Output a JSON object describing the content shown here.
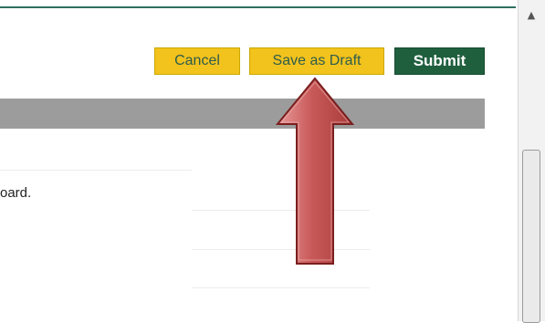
{
  "toolbar": {
    "cancel_label": "Cancel",
    "draft_label": "Save as Draft",
    "submit_label": "Submit"
  },
  "content": {
    "text": "oard."
  },
  "colors": {
    "accent_yellow": "#F2C21D",
    "submit_green": "#1F5F3E",
    "arrow_red": "#C95A5A"
  },
  "icons": {
    "scroll_up": "triangle-up",
    "callout": "arrow-up"
  }
}
